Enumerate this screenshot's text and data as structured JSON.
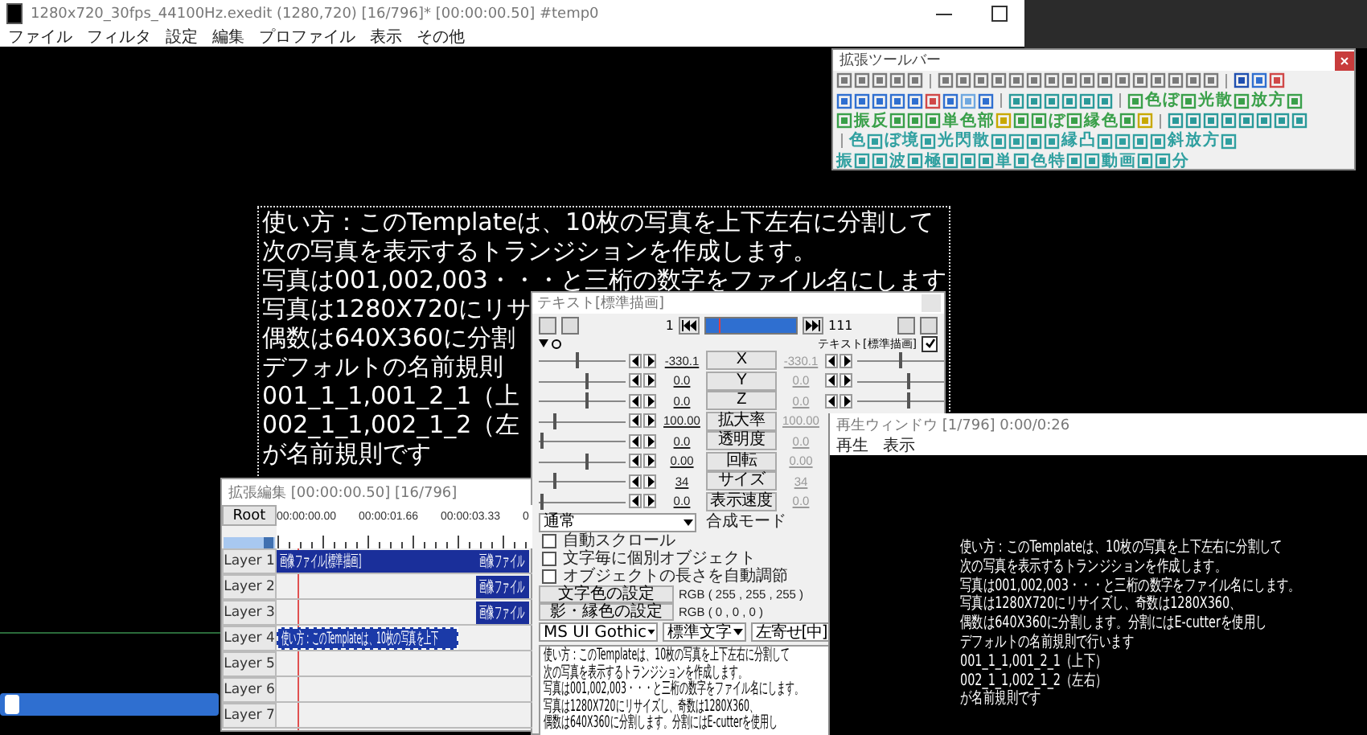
{
  "main_window": {
    "title": "1280x720_30fps_44100Hz.exedit (1280,720)  [16/796]*  [00:00:00.50]  #temp0",
    "menu": [
      "ファイル",
      "フィルタ",
      "設定",
      "編集",
      "プロファイル",
      "表示",
      "その他"
    ],
    "canvas_text": [
      "使い方：このTemplateは、10枚の写真を上下左右に分割して",
      "次の写真を表示するトランジションを作成します。",
      "写真は001,002,003・・・と三桁の数字をファイル名にします",
      "写真は1280X720にリサ",
      "偶数は640X360に分割",
      "デフォルトの名前規則",
      "001_1_1,001_2_1（上",
      "002_1_1,002_1_2（左",
      "が名前規則です"
    ],
    "seek_bar": {
      "level": 0.02
    }
  },
  "toolbar": {
    "title": "拡張ツールバー",
    "rows": [
      [
        {
          "kind": "icon",
          "color": "#7a7a7a"
        },
        {
          "kind": "icon",
          "color": "#7a7a7a"
        },
        {
          "kind": "icon",
          "color": "#7a7a7a"
        },
        {
          "kind": "icon",
          "color": "#7a7a7a"
        },
        {
          "kind": "icon",
          "color": "#7a7a7a"
        },
        {
          "kind": "separator"
        },
        {
          "kind": "icon",
          "color": "#7a7a7a"
        },
        {
          "kind": "icon",
          "color": "#7a7a7a"
        },
        {
          "kind": "icon",
          "color": "#7a7a7a"
        },
        {
          "kind": "icon",
          "color": "#7a7a7a"
        },
        {
          "kind": "icon",
          "color": "#7a7a7a"
        },
        {
          "kind": "icon",
          "color": "#7a7a7a"
        },
        {
          "kind": "icon",
          "color": "#7a7a7a"
        },
        {
          "kind": "icon",
          "color": "#7a7a7a"
        },
        {
          "kind": "icon",
          "color": "#7a7a7a"
        },
        {
          "kind": "icon",
          "color": "#7a7a7a"
        },
        {
          "kind": "icon",
          "color": "#7a7a7a"
        },
        {
          "kind": "icon",
          "color": "#7a7a7a"
        },
        {
          "kind": "icon",
          "color": "#7a7a7a"
        },
        {
          "kind": "icon",
          "color": "#7a7a7a"
        },
        {
          "kind": "icon",
          "color": "#7a7a7a"
        },
        {
          "kind": "icon",
          "color": "#7a7a7a"
        },
        {
          "kind": "separator"
        },
        {
          "kind": "icon",
          "color": "#1f4fb0"
        },
        {
          "kind": "icon",
          "color": "#2f6fd0"
        },
        {
          "kind": "icon",
          "color": "#d04848"
        }
      ],
      [
        {
          "kind": "icon",
          "color": "#2f6fd0"
        },
        {
          "kind": "icon",
          "color": "#2f6fd0"
        },
        {
          "kind": "icon",
          "color": "#2f6fd0"
        },
        {
          "kind": "icon",
          "color": "#2f6fd0"
        },
        {
          "kind": "icon",
          "color": "#2f6fd0"
        },
        {
          "kind": "icon",
          "color": "#d04848"
        },
        {
          "kind": "icon",
          "color": "#2f6fd0"
        },
        {
          "kind": "icon",
          "color": "#6fa8e0"
        },
        {
          "kind": "icon",
          "color": "#2f6fd0"
        },
        {
          "kind": "separator"
        },
        {
          "kind": "icon",
          "color": "#2a9a9a"
        },
        {
          "kind": "icon",
          "color": "#2a9a9a"
        },
        {
          "kind": "icon",
          "color": "#2a9a9a"
        },
        {
          "kind": "icon",
          "color": "#2a9a9a"
        },
        {
          "kind": "icon",
          "color": "#2a9a9a"
        },
        {
          "kind": "icon",
          "color": "#2a9a9a"
        },
        {
          "kind": "separator"
        },
        {
          "kind": "icon",
          "color": "#3aa04a"
        },
        {
          "kind": "glyph",
          "text": "色",
          "color": "#3aa04a"
        },
        {
          "kind": "glyph",
          "text": "ぼ",
          "color": "#3aa04a"
        },
        {
          "kind": "icon",
          "color": "#3aa04a"
        },
        {
          "kind": "glyph",
          "text": "光",
          "color": "#3aa04a"
        },
        {
          "kind": "glyph",
          "text": "散",
          "color": "#3aa04a"
        },
        {
          "kind": "icon",
          "color": "#3aa04a"
        },
        {
          "kind": "glyph",
          "text": "放",
          "color": "#3aa04a"
        },
        {
          "kind": "glyph",
          "text": "方",
          "color": "#3aa04a"
        },
        {
          "kind": "icon",
          "color": "#3aa04a"
        }
      ],
      [
        {
          "kind": "icon",
          "color": "#3aa04a"
        },
        {
          "kind": "glyph",
          "text": "振",
          "color": "#3aa04a"
        },
        {
          "kind": "glyph",
          "text": "反",
          "color": "#3aa04a"
        },
        {
          "kind": "icon",
          "color": "#3aa04a"
        },
        {
          "kind": "icon",
          "color": "#3aa04a"
        },
        {
          "kind": "icon",
          "color": "#3aa04a"
        },
        {
          "kind": "glyph",
          "text": "単",
          "color": "#3aa04a"
        },
        {
          "kind": "glyph",
          "text": "色",
          "color": "#3aa04a"
        },
        {
          "kind": "glyph",
          "text": "部",
          "color": "#3aa04a"
        },
        {
          "kind": "icon",
          "color": "#c8a800"
        },
        {
          "kind": "icon",
          "color": "#3aa04a"
        },
        {
          "kind": "icon",
          "color": "#3aa04a"
        },
        {
          "kind": "glyph",
          "text": "ぼ",
          "color": "#3aa04a"
        },
        {
          "kind": "icon",
          "color": "#3aa04a"
        },
        {
          "kind": "glyph",
          "text": "縁",
          "color": "#3aa04a"
        },
        {
          "kind": "glyph",
          "text": "色",
          "color": "#3aa04a"
        },
        {
          "kind": "icon",
          "color": "#3aa04a"
        },
        {
          "kind": "icon",
          "color": "#c8a800"
        },
        {
          "kind": "separator"
        },
        {
          "kind": "icon",
          "color": "#2a9a9a"
        },
        {
          "kind": "icon",
          "color": "#2a9a9a"
        },
        {
          "kind": "icon",
          "color": "#2a9a9a"
        },
        {
          "kind": "icon",
          "color": "#2a9a9a"
        },
        {
          "kind": "icon",
          "color": "#2a9a9a"
        },
        {
          "kind": "icon",
          "color": "#2a9a9a"
        },
        {
          "kind": "icon",
          "color": "#2a9a9a"
        },
        {
          "kind": "icon",
          "color": "#2a9a9a"
        }
      ],
      [
        {
          "kind": "separator"
        },
        {
          "kind": "glyph",
          "text": "色",
          "color": "#30a0a0"
        },
        {
          "kind": "icon",
          "color": "#30a0a0"
        },
        {
          "kind": "glyph",
          "text": "ぼ",
          "color": "#30a0a0"
        },
        {
          "kind": "glyph",
          "text": "境",
          "color": "#30a0a0"
        },
        {
          "kind": "icon",
          "color": "#30a0a0"
        },
        {
          "kind": "glyph",
          "text": "光",
          "color": "#30a0a0"
        },
        {
          "kind": "glyph",
          "text": "閃",
          "color": "#30a0a0"
        },
        {
          "kind": "glyph",
          "text": "散",
          "color": "#30a0a0"
        },
        {
          "kind": "icon",
          "color": "#30a0a0"
        },
        {
          "kind": "icon",
          "color": "#30a0a0"
        },
        {
          "kind": "icon",
          "color": "#30a0a0"
        },
        {
          "kind": "icon",
          "color": "#30a0a0"
        },
        {
          "kind": "glyph",
          "text": "縁",
          "color": "#30a0a0"
        },
        {
          "kind": "glyph",
          "text": "凸",
          "color": "#30a0a0"
        },
        {
          "kind": "icon",
          "color": "#30a0a0"
        },
        {
          "kind": "icon",
          "color": "#30a0a0"
        },
        {
          "kind": "icon",
          "color": "#30a0a0"
        },
        {
          "kind": "icon",
          "color": "#30a0a0"
        },
        {
          "kind": "glyph",
          "text": "斜",
          "color": "#30a0a0"
        },
        {
          "kind": "glyph",
          "text": "放",
          "color": "#30a0a0"
        },
        {
          "kind": "glyph",
          "text": "方",
          "color": "#30a0a0"
        },
        {
          "kind": "icon",
          "color": "#30a0a0"
        }
      ],
      [
        {
          "kind": "glyph",
          "text": "振",
          "color": "#30a0a0"
        },
        {
          "kind": "icon",
          "color": "#30a0a0"
        },
        {
          "kind": "icon",
          "color": "#30a0a0"
        },
        {
          "kind": "glyph",
          "text": "波",
          "color": "#30a0a0"
        },
        {
          "kind": "icon",
          "color": "#30a0a0"
        },
        {
          "kind": "glyph",
          "text": "極",
          "color": "#30a0a0"
        },
        {
          "kind": "icon",
          "color": "#30a0a0"
        },
        {
          "kind": "icon",
          "color": "#30a0a0"
        },
        {
          "kind": "icon",
          "color": "#30a0a0"
        },
        {
          "kind": "glyph",
          "text": "単",
          "color": "#30a0a0"
        },
        {
          "kind": "icon",
          "color": "#30a0a0"
        },
        {
          "kind": "glyph",
          "text": "色",
          "color": "#30a0a0"
        },
        {
          "kind": "glyph",
          "text": "特",
          "color": "#30a0a0"
        },
        {
          "kind": "icon",
          "color": "#30a0a0"
        },
        {
          "kind": "icon",
          "color": "#30a0a0"
        },
        {
          "kind": "glyph",
          "text": "動",
          "color": "#30a0a0"
        },
        {
          "kind": "glyph",
          "text": "画",
          "color": "#30a0a0"
        },
        {
          "kind": "icon",
          "color": "#30a0a0"
        },
        {
          "kind": "icon",
          "color": "#30a0a0"
        },
        {
          "kind": "glyph",
          "text": "分",
          "color": "#30a0a0"
        }
      ]
    ]
  },
  "timeline": {
    "title": "拡張編集 [00:00:00.50] [16/796]",
    "root": "Root",
    "ruler": [
      "00:00:00.00",
      "00:00:01.66",
      "00:00:03.33",
      "0"
    ],
    "layers": [
      {
        "name": "Layer 1",
        "clips": [
          {
            "kind": "lead",
            "label": "画像ファイル[標準描画]",
            "selected": false
          },
          {
            "kind": "follow",
            "label": "画像ファイル",
            "selected": false
          }
        ]
      },
      {
        "name": "Layer 2",
        "clips": [
          {
            "kind": "follow",
            "label": "画像ファイル",
            "selected": false
          }
        ]
      },
      {
        "name": "Layer 3",
        "clips": [
          {
            "kind": "follow",
            "label": "画像ファイル",
            "selected": false
          }
        ]
      },
      {
        "name": "Layer 4",
        "clips": [
          {
            "kind": "caption",
            "label": "使い方：このTemplateは、10枚の写真を上下",
            "selected": true
          }
        ]
      },
      {
        "name": "Layer 5"
      },
      {
        "name": "Layer 6"
      },
      {
        "name": "Layer 7"
      }
    ]
  },
  "object_dialog": {
    "title": "テキスト[標準描画]",
    "frame_start": "1",
    "frame_end": "111",
    "frame_bar": {
      "level": 0.14
    },
    "filter_name": "テキスト[標準描画]",
    "filter_enabled": true,
    "params": [
      {
        "name": "X",
        "value": "-330.1",
        "end_value": "-330.1",
        "level": 0.45,
        "end_slider": {
          "level": 0.5
        }
      },
      {
        "name": "Y",
        "value": "0.0",
        "end_value": "0.0",
        "level": 0.55,
        "end_slider": {
          "level": 0.6
        }
      },
      {
        "name": "Z",
        "value": "0.0",
        "end_value": "0.0",
        "level": 0.55,
        "end_slider": {
          "level": 0.6
        }
      },
      {
        "name": "拡大率",
        "value": "100.00",
        "end_value": "100.00",
        "level": 0.18
      },
      {
        "name": "透明度",
        "value": "0.0",
        "end_value": "0.0",
        "level": 0.02
      },
      {
        "name": "回転",
        "value": "0.00",
        "end_value": "0.00",
        "level": 0.55
      },
      {
        "name": "サイズ",
        "value": "34",
        "end_value": "34",
        "level": 0.18
      },
      {
        "name": "表示速度",
        "value": "0.0",
        "end_value": "0.0",
        "level": 0.02
      }
    ],
    "blend_mode": "通常",
    "blend_label": "合成モード",
    "options": [
      {
        "label": "自動スクロール",
        "checked": false
      },
      {
        "label": "文字毎に個別オブジェクト",
        "checked": false
      },
      {
        "label": "オブジェクトの長さを自動調節",
        "checked": false
      }
    ],
    "colors": [
      {
        "button": "文字色の設定",
        "value": "RGB ( 255 , 255 , 255 )"
      },
      {
        "button": "影・縁色の設定",
        "value": "RGB ( 0 , 0 , 0 )"
      }
    ],
    "font": "MS UI Gothic",
    "style": "標準文字",
    "align": "左寄せ[中]",
    "text": [
      "使い方：このTemplateは、10枚の写真を上下左右に分割して",
      "次の写真を表示するトランジションを作成します。",
      "写真は001,002,003・・・と三桁の数字をファイル名にします。",
      "写真は1280X720にリサイズし、奇数は1280X360、",
      "偶数は640X360に分割します。分割にはE-cutterを使用し"
    ]
  },
  "preview": {
    "title": "再生ウィンドウ [1/796]  0:00/0:26",
    "menu": [
      "再生",
      "表示"
    ],
    "lines": [
      "使い方：このTemplateは、10枚の写真を上下左右に分割して",
      "次の写真を表示するトランジションを作成します。",
      "写真は001,002,003・・・と三桁の数字をファイル名にします。",
      "写真は1280X720にリサイズし、奇数は1280X360、",
      "偶数は640X360に分割します。分割にはE-cutterを使用し",
      "デフォルトの名前規則で行います",
      "001_1_1,001_2_1（上下）",
      "002_1_1,002_1_2（左右）",
      "が名前規則です"
    ]
  }
}
